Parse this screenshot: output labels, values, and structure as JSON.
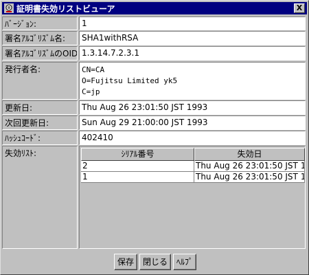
{
  "window": {
    "title": "証明書失効リストビューア",
    "close_label": "X"
  },
  "fields": {
    "version": {
      "label": "ﾊﾞｰｼﾞｮﾝ:",
      "value": "1"
    },
    "sig_alg_name": {
      "label": "署名ｱﾙｺﾞﾘｽﾞﾑ名:",
      "value": "SHA1withRSA"
    },
    "sig_alg_oid": {
      "label": "署名ｱﾙｺﾞﾘｽﾞﾑのOID:",
      "value": "1.3.14.7.2.3.1"
    },
    "issuer": {
      "label": "発行者名:",
      "lines": [
        "CN=CA",
        "O=Fujitsu Limited yk5",
        "C=jp"
      ]
    },
    "update_date": {
      "label": "更新日:",
      "value": "Thu Aug 26 23:01:50 JST 1993"
    },
    "next_update": {
      "label": "次回更新日:",
      "value": "Sun Aug 29 21:00:00 JST 1993"
    },
    "hash_code": {
      "label": "ﾊｯｼｭｺｰﾄﾞ:",
      "value": "402410"
    },
    "revoked_list": {
      "label": "失効ﾘｽﾄ:"
    }
  },
  "revoked_table": {
    "headers": [
      "ｼﾘｱﾙ番号",
      "失効日"
    ],
    "rows": [
      [
        "2",
        "Thu Aug 26 23:01:50 JST 1..."
      ],
      [
        "1",
        "Thu Aug 26 23:01:50 JST 1..."
      ]
    ]
  },
  "buttons": {
    "save": "保存",
    "close": "閉じる",
    "help": "ﾍﾙﾌﾟ"
  }
}
